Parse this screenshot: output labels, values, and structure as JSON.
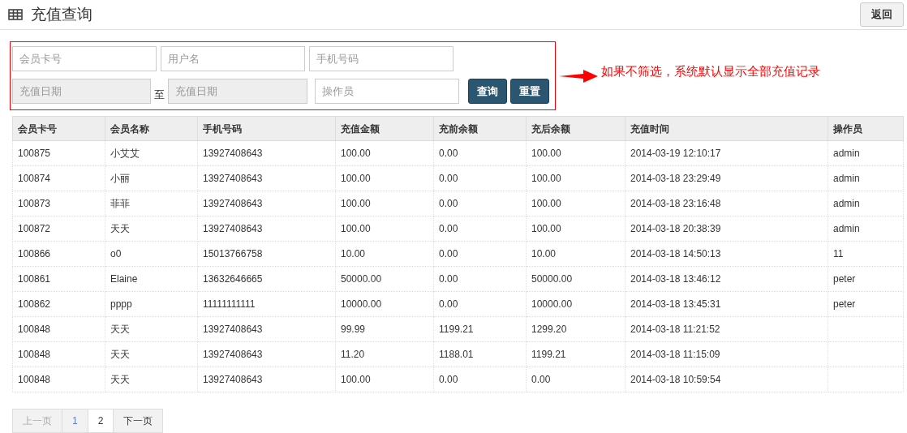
{
  "header": {
    "title": "充值查询",
    "back_button": "返回"
  },
  "filters": {
    "fields": [
      {
        "placeholder": "会员卡号",
        "disabled": false
      },
      {
        "placeholder": "用户名",
        "disabled": false
      },
      {
        "placeholder": "手机号码",
        "disabled": false
      }
    ],
    "date_from": {
      "placeholder": "充值日期",
      "disabled": true
    },
    "range_separator": "至",
    "date_to": {
      "placeholder": "充值日期",
      "disabled": true
    },
    "operator": {
      "placeholder": "操作员",
      "disabled": false
    },
    "buttons": [
      "查询",
      "重置"
    ]
  },
  "annotation": "如果不筛选，系统默认显示全部充值记录",
  "table": {
    "columns": [
      "会员卡号",
      "会员名称",
      "手机号码",
      "充值金额",
      "充前余额",
      "充后余额",
      "充值时间",
      "操作员"
    ],
    "rows": [
      [
        "100875",
        "小艾艾",
        "13927408643",
        "100.00",
        "0.00",
        "100.00",
        "2014-03-19 12:10:17",
        "admin"
      ],
      [
        "100874",
        "小丽",
        "13927408643",
        "100.00",
        "0.00",
        "100.00",
        "2014-03-18 23:29:49",
        "admin"
      ],
      [
        "100873",
        "菲菲",
        "13927408643",
        "100.00",
        "0.00",
        "100.00",
        "2014-03-18 23:16:48",
        "admin"
      ],
      [
        "100872",
        "天天",
        "13927408643",
        "100.00",
        "0.00",
        "100.00",
        "2014-03-18 20:38:39",
        "admin"
      ],
      [
        "100866",
        "o0",
        "15013766758",
        "10.00",
        "0.00",
        "10.00",
        "2014-03-18 14:50:13",
        "11"
      ],
      [
        "100861",
        "Elaine",
        "13632646665",
        "50000.00",
        "0.00",
        "50000.00",
        "2014-03-18 13:46:12",
        "peter"
      ],
      [
        "100862",
        "pppp",
        "11111111111",
        "10000.00",
        "0.00",
        "10000.00",
        "2014-03-18 13:45:31",
        "peter"
      ],
      [
        "100848",
        "天天",
        "13927408643",
        "99.99",
        "1199.21",
        "1299.20",
        "2014-03-18 11:21:52"
      ],
      [
        "100848",
        "天天",
        "13927408643",
        "11.20",
        "1188.01",
        "1199.21",
        "2014-03-18 11:15:09"
      ],
      [
        "100848",
        "天天",
        "13927408643",
        "100.00",
        "0.00",
        "0.00",
        "2014-03-18 10:59:54"
      ]
    ]
  },
  "pagination": {
    "prev": {
      "label": "上一页",
      "disabled": true
    },
    "pages": [
      {
        "label": "1",
        "selected": true
      },
      {
        "label": "2",
        "selected": false
      }
    ],
    "next": {
      "label": "下一页",
      "disabled": false
    }
  }
}
